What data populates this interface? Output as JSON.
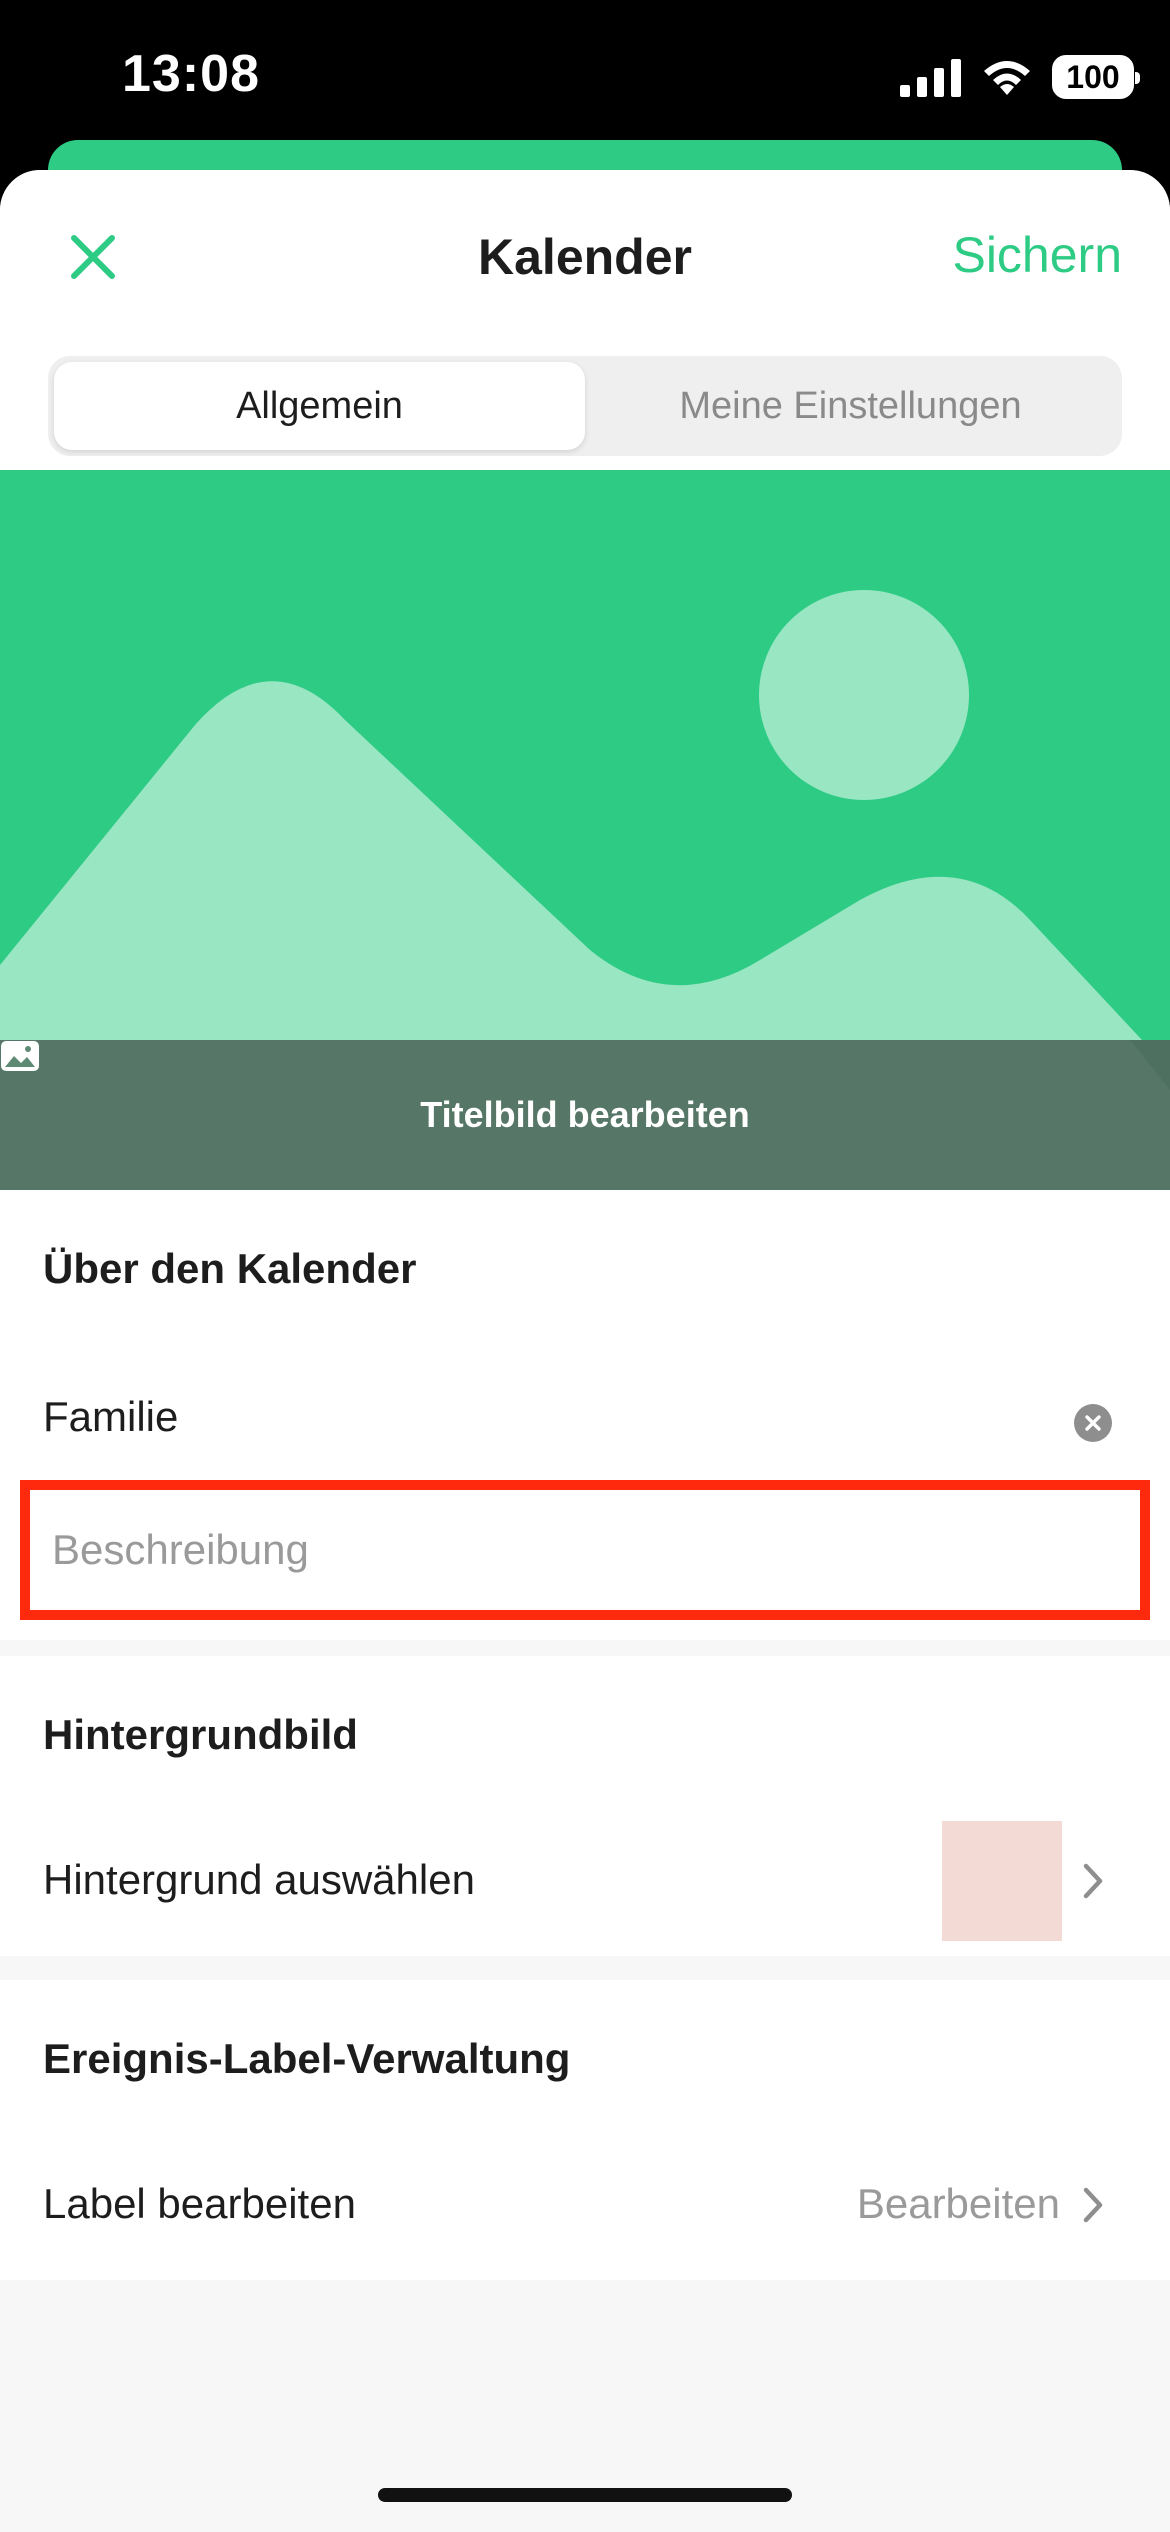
{
  "status_bar": {
    "time": "13:08",
    "battery": "100"
  },
  "nav": {
    "title": "Kalender",
    "save_label": "Sichern",
    "close_icon": "close-icon"
  },
  "tabs": [
    {
      "label": "Allgemein",
      "active": true
    },
    {
      "label": "Meine Einstellungen",
      "active": false
    }
  ],
  "cover": {
    "edit_label": "Titelbild bearbeiten",
    "icon": "image-icon"
  },
  "about": {
    "title": "Über den Kalender",
    "name_value": "Familie",
    "description_placeholder": "Beschreibung"
  },
  "background": {
    "title": "Hintergrundbild",
    "select_label": "Hintergrund auswählen",
    "swatch_color": "#f4dad4"
  },
  "labels": {
    "title": "Ereignis-Label-Verwaltung",
    "edit_label": "Label bearbeiten",
    "edit_value": "Bearbeiten"
  },
  "colors": {
    "accent": "#2ecb85",
    "highlight_border": "#ff2a0e"
  }
}
